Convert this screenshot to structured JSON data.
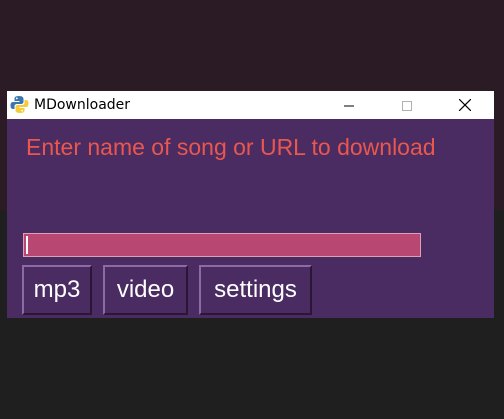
{
  "window": {
    "title": "MDownloader",
    "icon": "python-icon"
  },
  "controls": {
    "minimize_icon": "minimize-icon",
    "maximize_icon": "maximize-icon",
    "close_icon": "close-icon"
  },
  "main": {
    "prompt": "Enter name of song or URL to download",
    "input_value": "",
    "buttons": {
      "mp3": "mp3",
      "video": "video",
      "settings": "settings"
    }
  },
  "colors": {
    "window_bg": "#4a2b62",
    "prompt_text": "#e8584e",
    "input_bg": "#b84872"
  }
}
